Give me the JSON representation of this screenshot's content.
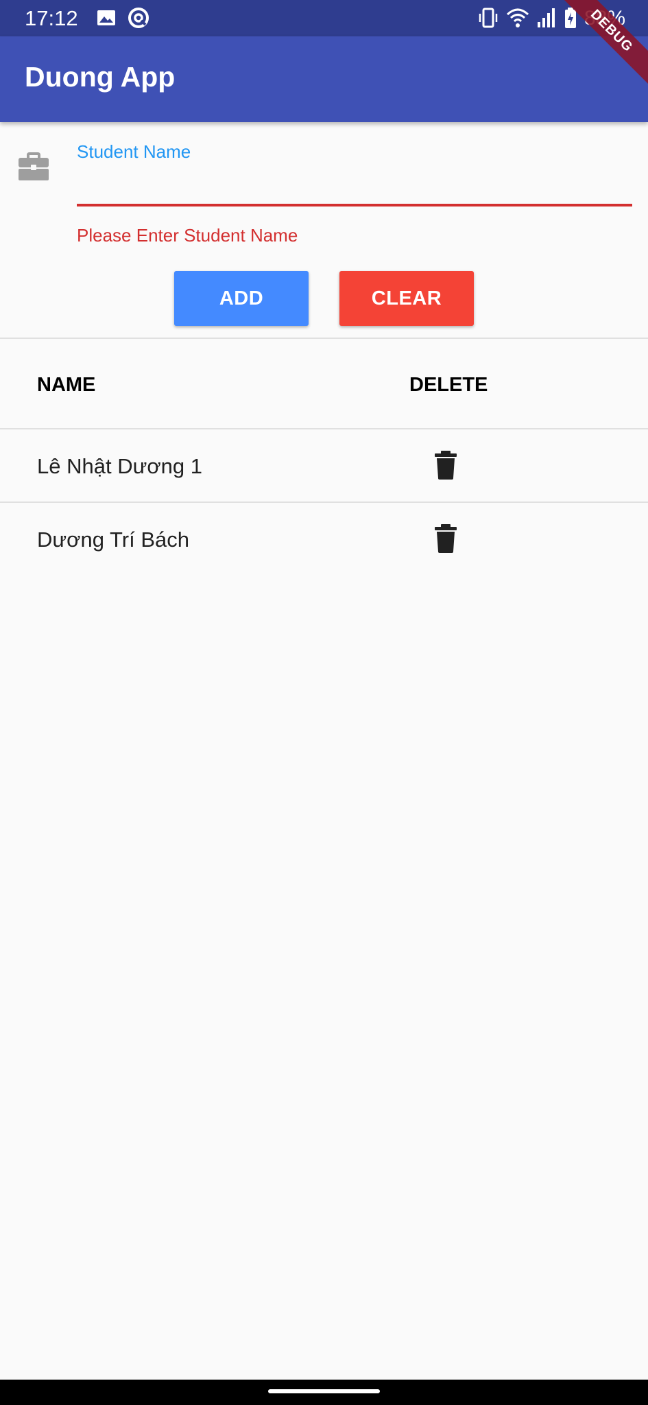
{
  "status_bar": {
    "time": "17:12",
    "battery": "88%",
    "icons": [
      "image-icon",
      "at-sign-icon",
      "vibrate-icon",
      "wifi-icon",
      "cell-signal-icon",
      "battery-charging-icon"
    ]
  },
  "app_bar": {
    "title": "Duong App"
  },
  "debug_banner": "DEBUG",
  "form": {
    "icon": "briefcase-icon",
    "label": "Student Name",
    "value": "",
    "error": "Please Enter Student Name",
    "add_label": "ADD",
    "clear_label": "CLEAR"
  },
  "table": {
    "headers": {
      "name": "NAME",
      "delete": "DELETE"
    },
    "rows": [
      {
        "name": "Lê Nhật Dương 1",
        "delete_icon": "trash-icon"
      },
      {
        "name": "Dương Trí Bách",
        "delete_icon": "trash-icon"
      }
    ]
  },
  "colors": {
    "status_bar": "#2f3d8f",
    "app_bar": "#3f51b5",
    "label_blue": "#2196f3",
    "error_red": "#d32f2f",
    "add_button": "#448aff",
    "clear_button": "#f44336"
  }
}
